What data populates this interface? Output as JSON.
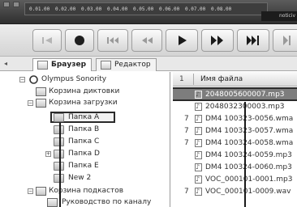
{
  "display": {
    "scale_marks": [
      "0.01.00",
      "0.02.00",
      "0.03.00",
      "0.04.00",
      "0.05.00",
      "0.06.00",
      "0.07.00",
      "0.08.00"
    ],
    "corner_text": "noticiv"
  },
  "transport": {
    "buttons": [
      {
        "name": "skip-to-start-icon"
      },
      {
        "name": "record-icon"
      },
      {
        "name": "skip-back-icon"
      },
      {
        "name": "rewind-icon"
      },
      {
        "name": "play-icon"
      },
      {
        "name": "fast-forward-icon"
      },
      {
        "name": "skip-forward-icon"
      }
    ]
  },
  "tabs": [
    {
      "label": "Браузер",
      "active": true
    },
    {
      "label": "Редактор",
      "active": false
    }
  ],
  "tree": {
    "root": "Olympus Sonority",
    "items": [
      {
        "label": "Корзина диктовки"
      },
      {
        "label": "Корзина загрузки"
      },
      {
        "label": "Папка A"
      },
      {
        "label": "Папка B"
      },
      {
        "label": "Папка C"
      },
      {
        "label": "Папка D"
      },
      {
        "label": "Папка E"
      },
      {
        "label": "New 2"
      },
      {
        "label": "Корзина подкастов"
      },
      {
        "label": "Руководство по каналу"
      }
    ]
  },
  "list": {
    "column_number": "1",
    "column_filename": "Имя файла",
    "rows": [
      {
        "num": "",
        "name": "2048005600007.mp3",
        "selected": true
      },
      {
        "num": "",
        "name": "2048032300003.mp3",
        "selected": false
      },
      {
        "num": "7",
        "name": "DM4 100323-0056.wma",
        "selected": false
      },
      {
        "num": "7",
        "name": "DM4 100323-0057.wma",
        "selected": false
      },
      {
        "num": "7",
        "name": "DM4 100324-0058.wma",
        "selected": false
      },
      {
        "num": "",
        "name": "DM4 100324-0059.mp3",
        "selected": false
      },
      {
        "num": "",
        "name": "DM4 100324-0060.mp3",
        "selected": false
      },
      {
        "num": "",
        "name": "VOC_000101-0001.mp3",
        "selected": false
      },
      {
        "num": "7",
        "name": "VOC_000101-0009.wav",
        "selected": false
      }
    ]
  }
}
